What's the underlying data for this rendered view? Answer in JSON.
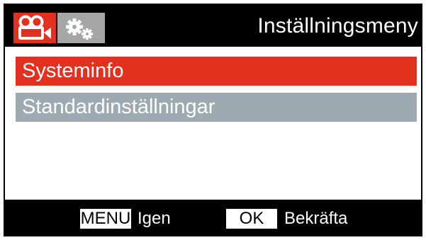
{
  "header": {
    "title": "Inställningsmeny",
    "tabs": [
      {
        "icon": "video-camera-icon",
        "active": true,
        "color": "#e3301f"
      },
      {
        "icon": "gears-icon",
        "active": false,
        "color": "#a6a6a6"
      }
    ]
  },
  "menu": {
    "items": [
      {
        "label": "Systeminfo",
        "selected": true
      },
      {
        "label": "Standardinställningar",
        "selected": false
      }
    ]
  },
  "footer": {
    "menu_key": "MENU",
    "menu_action": "Igen",
    "ok_key": "OK",
    "ok_action": "Bekräfta"
  },
  "colors": {
    "accent": "#e3301f",
    "secondary_row": "#9eaab2",
    "bar": "#000000"
  }
}
